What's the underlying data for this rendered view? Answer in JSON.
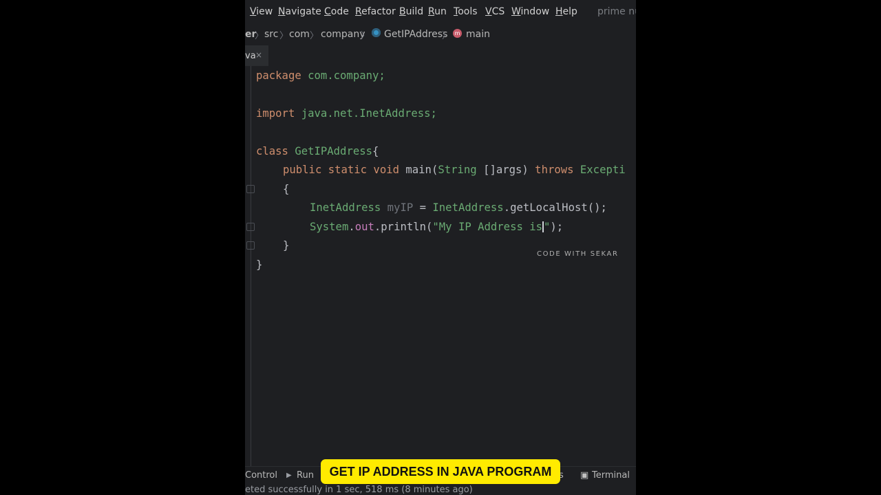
{
  "menu": {
    "items": [
      "View",
      "Navigate",
      "Code",
      "Refactor",
      "Build",
      "Run",
      "Tools",
      "VCS",
      "Window",
      "Help"
    ],
    "project_name": "prime nu"
  },
  "breadcrumbs": [
    "er",
    "src",
    "com",
    "company",
    "GetIPAddress",
    "main"
  ],
  "tab": {
    "label": "va",
    "close_glyph": "×"
  },
  "code": {
    "line1_kw": "package",
    "line1_rest": " com.company;",
    "line2_kw": "import",
    "line2_rest": " java.net.InetAddress;",
    "line3_kw": "class",
    "line3_name": " GetIPAddress",
    "line3_brace": "{",
    "line4_mods": "public static void",
    "line4_name": " main",
    "line4_paren": "(",
    "line4_type": "String",
    "line4_args": " []args)",
    "line4_throws": " throws",
    "line4_exc": " Excepti",
    "line5": "{",
    "line6_type": "InetAddress",
    "line6_var": " myIP",
    "line6_eq": " = ",
    "line6_cls": "InetAddress",
    "line6_call": ".getLocalHost();",
    "line7_sys": "System",
    "line7_dot": ".",
    "line7_out": "out",
    "line7_call": ".println(",
    "line7_str": "\"My IP Address is",
    "line7_strend": "\"",
    "line7_end": ");",
    "line8": "}",
    "line9": "}"
  },
  "watermark": "CODE WITH SEKAR",
  "bottom_tools": {
    "control": "Control",
    "run": "Run",
    "partial": "s",
    "terminal": "Terminal"
  },
  "status": "eted successfully in 1 sec, 518 ms (8 minutes ago)",
  "banner": "GET IP ADDRESS IN JAVA PROGRAM",
  "icons": {
    "terminal": "terminal-icon",
    "run": "run-icon",
    "class": "class-icon",
    "method": "method-icon"
  },
  "method_icon_glyph": "m",
  "terminal_glyph": "▣",
  "run_glyph": "▶",
  "sep_glyph": "〉"
}
